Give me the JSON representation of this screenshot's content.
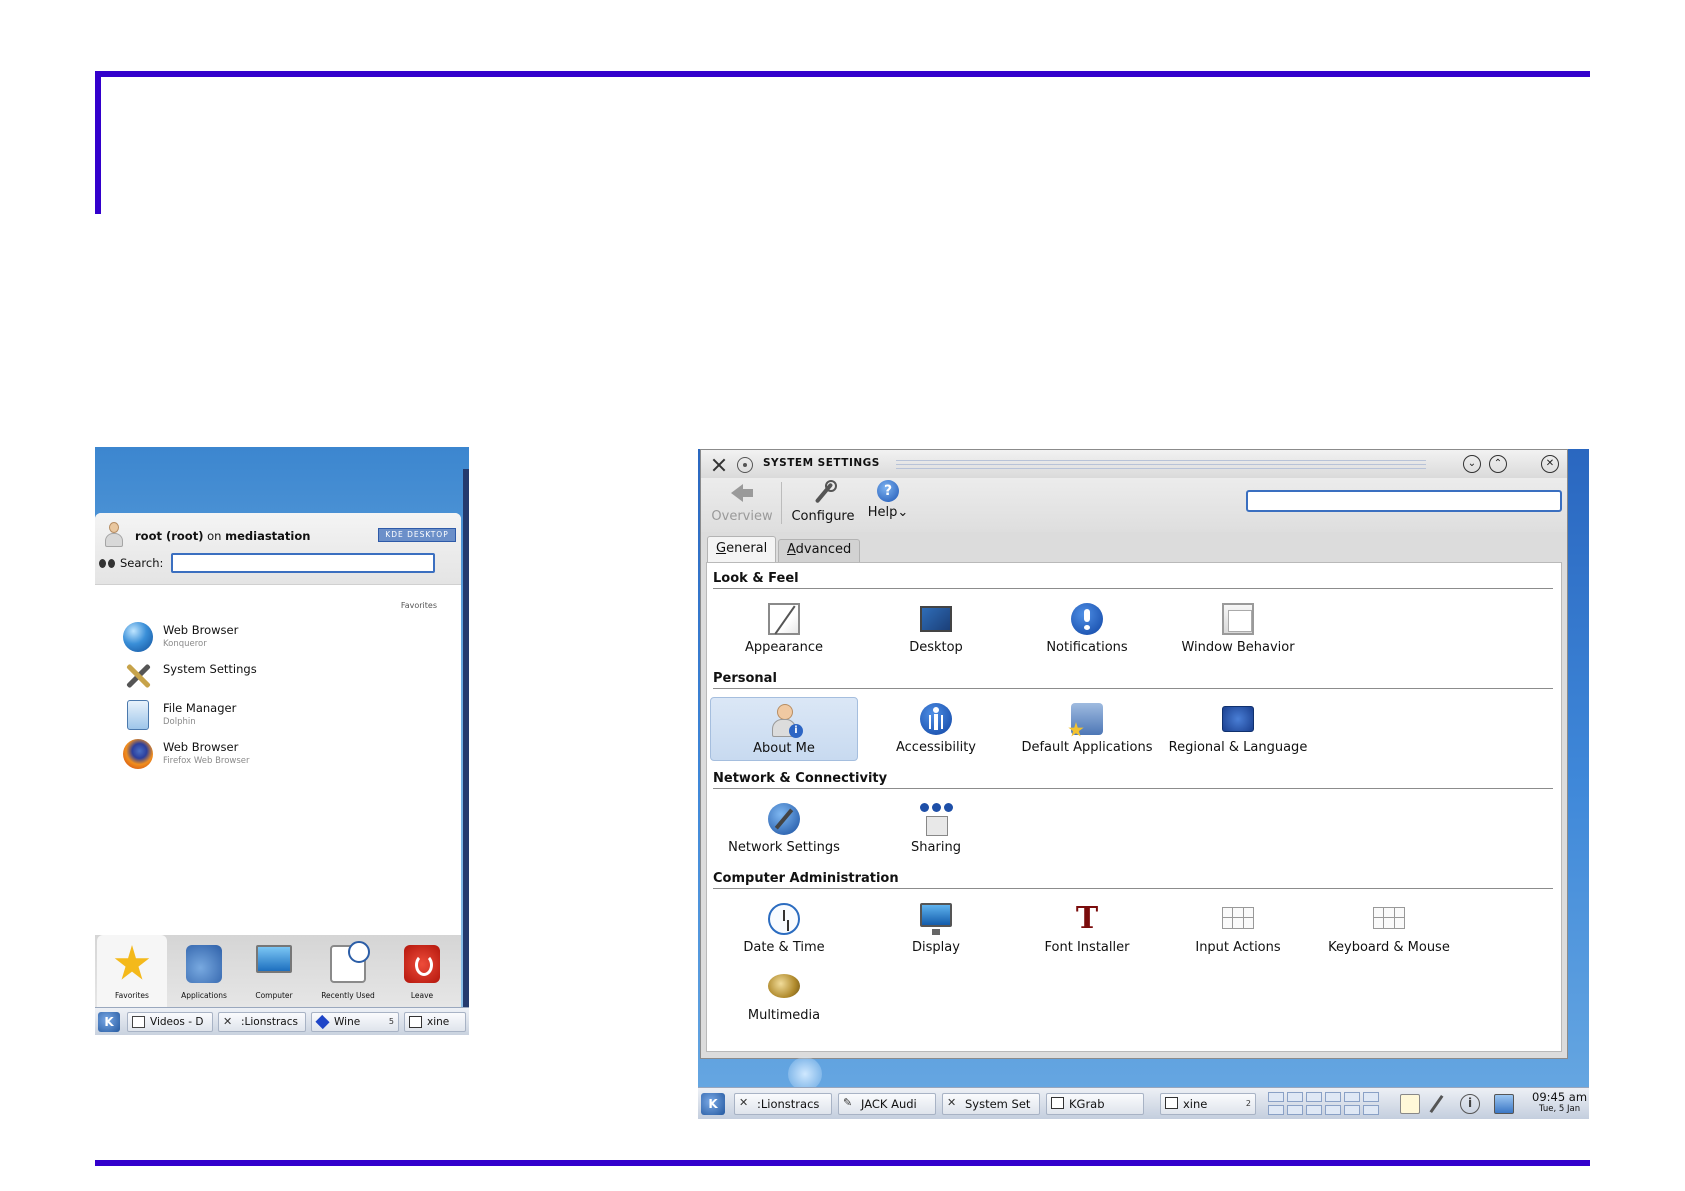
{
  "launcher": {
    "user_name": "root (root)",
    "user_on": " on ",
    "host": "mediastation",
    "kde_badge": "KDE DESKTOP",
    "search_label": "Search:",
    "search_value": "",
    "favorites_title": "Favorites",
    "favorites": [
      {
        "name": "Web Browser",
        "sub": "Konqueror",
        "icon": "globe-icon"
      },
      {
        "name": "System Settings",
        "sub": "",
        "icon": "tools-icon"
      },
      {
        "name": "File Manager",
        "sub": "Dolphin",
        "icon": "dolphin-icon"
      },
      {
        "name": "Web Browser",
        "sub": "Firefox Web Browser",
        "icon": "firefox-icon"
      }
    ],
    "tabs": [
      {
        "label": "Favorites",
        "icon": "star-icon",
        "active": true
      },
      {
        "label": "Applications",
        "icon": "applications-icon"
      },
      {
        "label": "Computer",
        "icon": "computer-icon"
      },
      {
        "label": "Recently Used",
        "icon": "recently-used-icon"
      },
      {
        "label": "Leave",
        "icon": "leave-icon"
      }
    ],
    "taskbar": {
      "start": "K",
      "items": [
        {
          "label": "Videos - D",
          "icon": "document-icon"
        },
        {
          "label": ":Lionstracs",
          "icon": "x-icon"
        },
        {
          "label": "Wine",
          "icon": "wine-icon",
          "num": "5"
        },
        {
          "label": "xine",
          "icon": "screen-icon"
        }
      ]
    }
  },
  "settings": {
    "title": "SYSTEM SETTINGS",
    "window_buttons": {
      "minimize": "⌄",
      "maximize": "⌃",
      "close": "✕"
    },
    "toolbar": {
      "overview": "Overview",
      "configure": "Configure",
      "help": "Help",
      "help_arrow": "⌄"
    },
    "search_value": "",
    "tabs": {
      "general_accel": "G",
      "general_rest": "eneral",
      "advanced_accel": "A",
      "advanced_rest": "dvanced"
    },
    "sections": [
      {
        "title": "Look & Feel",
        "items": [
          {
            "label": "Appearance",
            "icon": "appearance-icon"
          },
          {
            "label": "Desktop",
            "icon": "desktop-icon"
          },
          {
            "label": "Notifications",
            "icon": "notifications-icon"
          },
          {
            "label": "Window Behavior",
            "icon": "window-behavior-icon"
          }
        ]
      },
      {
        "title": "Personal",
        "items": [
          {
            "label": "About Me",
            "icon": "about-me-icon",
            "selected": true
          },
          {
            "label": "Accessibility",
            "icon": "accessibility-icon"
          },
          {
            "label": "Default Applications",
            "icon": "default-applications-icon"
          },
          {
            "label": "Regional & Language",
            "icon": "regional-language-icon"
          }
        ]
      },
      {
        "title": "Network & Connectivity",
        "items": [
          {
            "label": "Network Settings",
            "icon": "network-settings-icon"
          },
          {
            "label": "Sharing",
            "icon": "sharing-icon"
          }
        ]
      },
      {
        "title": "Computer Administration",
        "items": [
          {
            "label": "Date & Time",
            "icon": "date-time-icon"
          },
          {
            "label": "Display",
            "icon": "display-icon"
          },
          {
            "label": "Font Installer",
            "icon": "font-installer-icon",
            "glyph": "T"
          },
          {
            "label": "Input Actions",
            "icon": "input-actions-icon"
          },
          {
            "label": "Keyboard & Mouse",
            "icon": "keyboard-mouse-icon"
          },
          {
            "label": "Multimedia",
            "icon": "multimedia-icon"
          }
        ]
      }
    ],
    "taskbar": {
      "start": "K",
      "items": [
        {
          "label": ":Lionstracs",
          "icon": "x-icon"
        },
        {
          "label": "JACK Audi",
          "icon": "jack-icon"
        },
        {
          "label": "System Set",
          "icon": "tools-icon"
        },
        {
          "label": "KGrab",
          "icon": "kgrab-icon"
        },
        {
          "label": "xine",
          "icon": "screen-icon",
          "num": "2"
        }
      ],
      "tray_info": "i",
      "clock_time": "09:45 am",
      "clock_date": "Tue, 5 Jan"
    }
  },
  "colors": {
    "frame": "#3300cc",
    "selection": "#c8daf0",
    "accent": "#3a6fc0"
  }
}
